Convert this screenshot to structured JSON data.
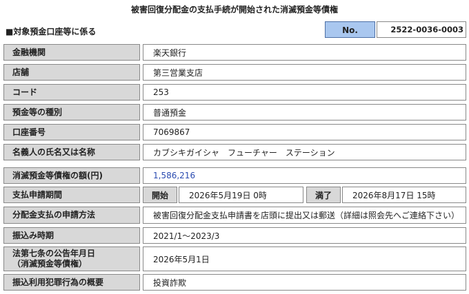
{
  "title": "被害回復分配金の支払手続が開始された消滅預金等債権",
  "section": "■対象預金口座等に係る",
  "no_label": "No.",
  "no_value": "2522-0036-0003",
  "rows": {
    "bank": {
      "label": "金融機関",
      "value": "楽天銀行"
    },
    "branch": {
      "label": "店舗",
      "value": "第三営業支店"
    },
    "code": {
      "label": "コード",
      "value": "253"
    },
    "deposit_type": {
      "label": "預金等の種別",
      "value": "普通預金"
    },
    "account_number": {
      "label": "口座番号",
      "value": "7069867"
    },
    "holder_name": {
      "label": "名義人の氏名又は名称",
      "value": "カブシキガイシャ　フューチャー　ステーション"
    },
    "claim_amount": {
      "label": "消滅預金等債権の額(円)",
      "value": "1,586,216"
    },
    "payment_period": {
      "label": "支払申請期間",
      "start_label": "開始",
      "start_value": "2026年5月19日 0時",
      "end_label": "満了",
      "end_value": "2026年8月17日 15時"
    },
    "application_method": {
      "label": "分配金支払の申請方法",
      "value": "被害回復分配金支払申請書を店頭に提出又は郵送（詳細は照会先へご連絡下さい）"
    },
    "transfer_period": {
      "label": "振込み時期",
      "value": "2021/1～2023/3"
    },
    "notice_date": {
      "label_line1": "法第七条の公告年月日",
      "label_line2": "（消滅預金等債権）",
      "value": "2026年5月1日"
    },
    "crime_summary": {
      "label": "振込利用犯罪行為の概要",
      "value": "投資詐欺"
    }
  }
}
